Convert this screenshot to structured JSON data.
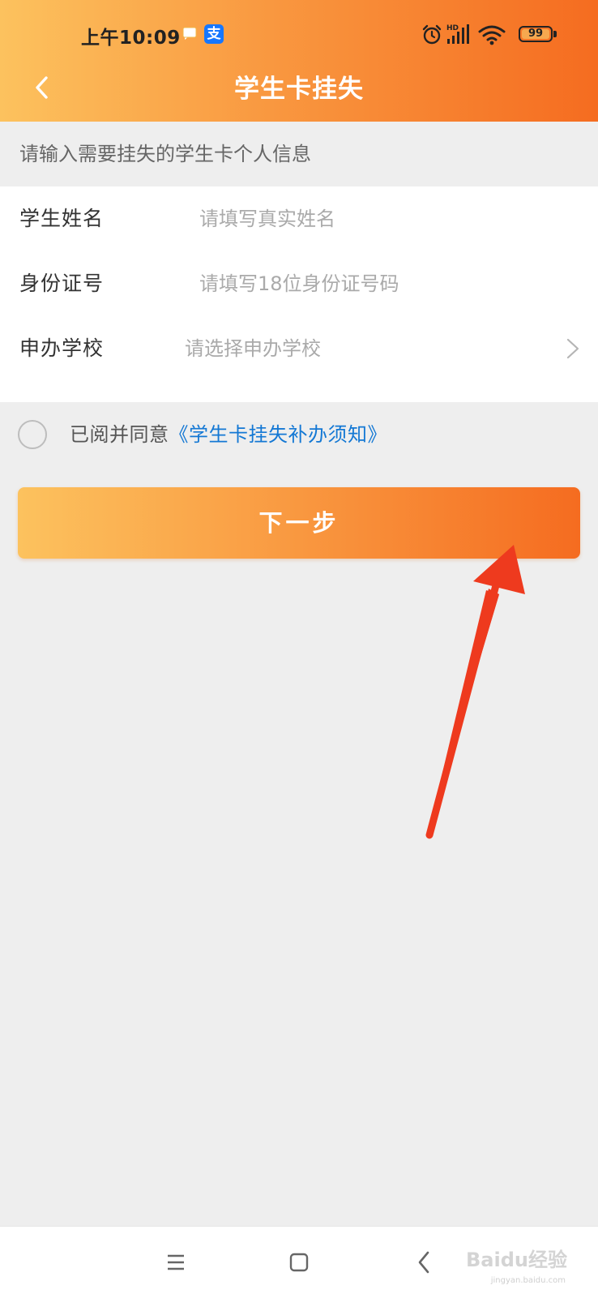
{
  "status_bar": {
    "time": "上午10:09",
    "battery_level": "99",
    "icons": [
      "message-icon",
      "alipay-icon",
      "alarm-icon",
      "hd-signal-icon",
      "wifi-icon",
      "battery-icon"
    ]
  },
  "header": {
    "title": "学生卡挂失",
    "back_icon": "chevron-left-icon"
  },
  "hint": "请输入需要挂失的学生卡个人信息",
  "form": {
    "name": {
      "label": "学生姓名",
      "placeholder": "请填写真实姓名",
      "value": ""
    },
    "id_number": {
      "label": "身份证号",
      "placeholder": "请填写18位身份证号码",
      "value": ""
    },
    "school": {
      "label": "申办学校",
      "placeholder": "请选择申办学校"
    }
  },
  "agreement": {
    "prefix": "已阅并同意",
    "link": "《学生卡挂失补办须知》",
    "checked": false
  },
  "next_button": "下一步",
  "watermark": {
    "main": "Baidu经验",
    "sub": "jingyan.baidu.com"
  },
  "colors": {
    "gradient_start": "#fcc25e",
    "gradient_end": "#f56c20",
    "link": "#1478d4",
    "annotation_arrow": "#ee3a1e"
  }
}
